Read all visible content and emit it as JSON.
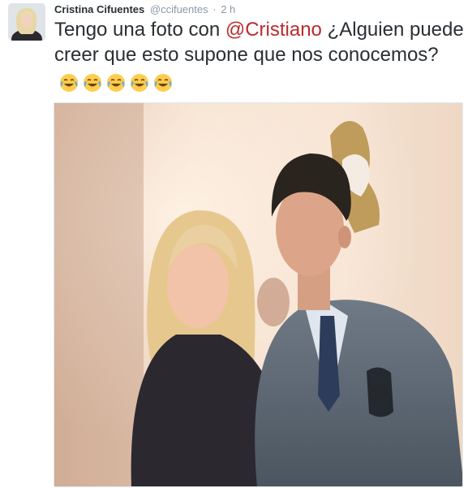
{
  "tweet": {
    "author_name": "Cristina Cifuentes",
    "author_handle": "@ccifuentes",
    "separator": "·",
    "time": "2 h",
    "text_before_mention": "Tengo una foto con ",
    "mention": "@Cristiano",
    "text_after_mention": " ¿Alguien puede creer que esto supone que nos conocemos? ",
    "emojis": [
      "face-with-tears-of-joy-icon",
      "face-with-tears-of-joy-icon",
      "face-with-tears-of-joy-icon",
      "face-with-tears-of-joy-icon",
      "face-with-tears-of-joy-icon"
    ]
  },
  "colors": {
    "mention": "#ba2c2c",
    "meta_text": "#8899a6",
    "body_text": "#292f33"
  }
}
